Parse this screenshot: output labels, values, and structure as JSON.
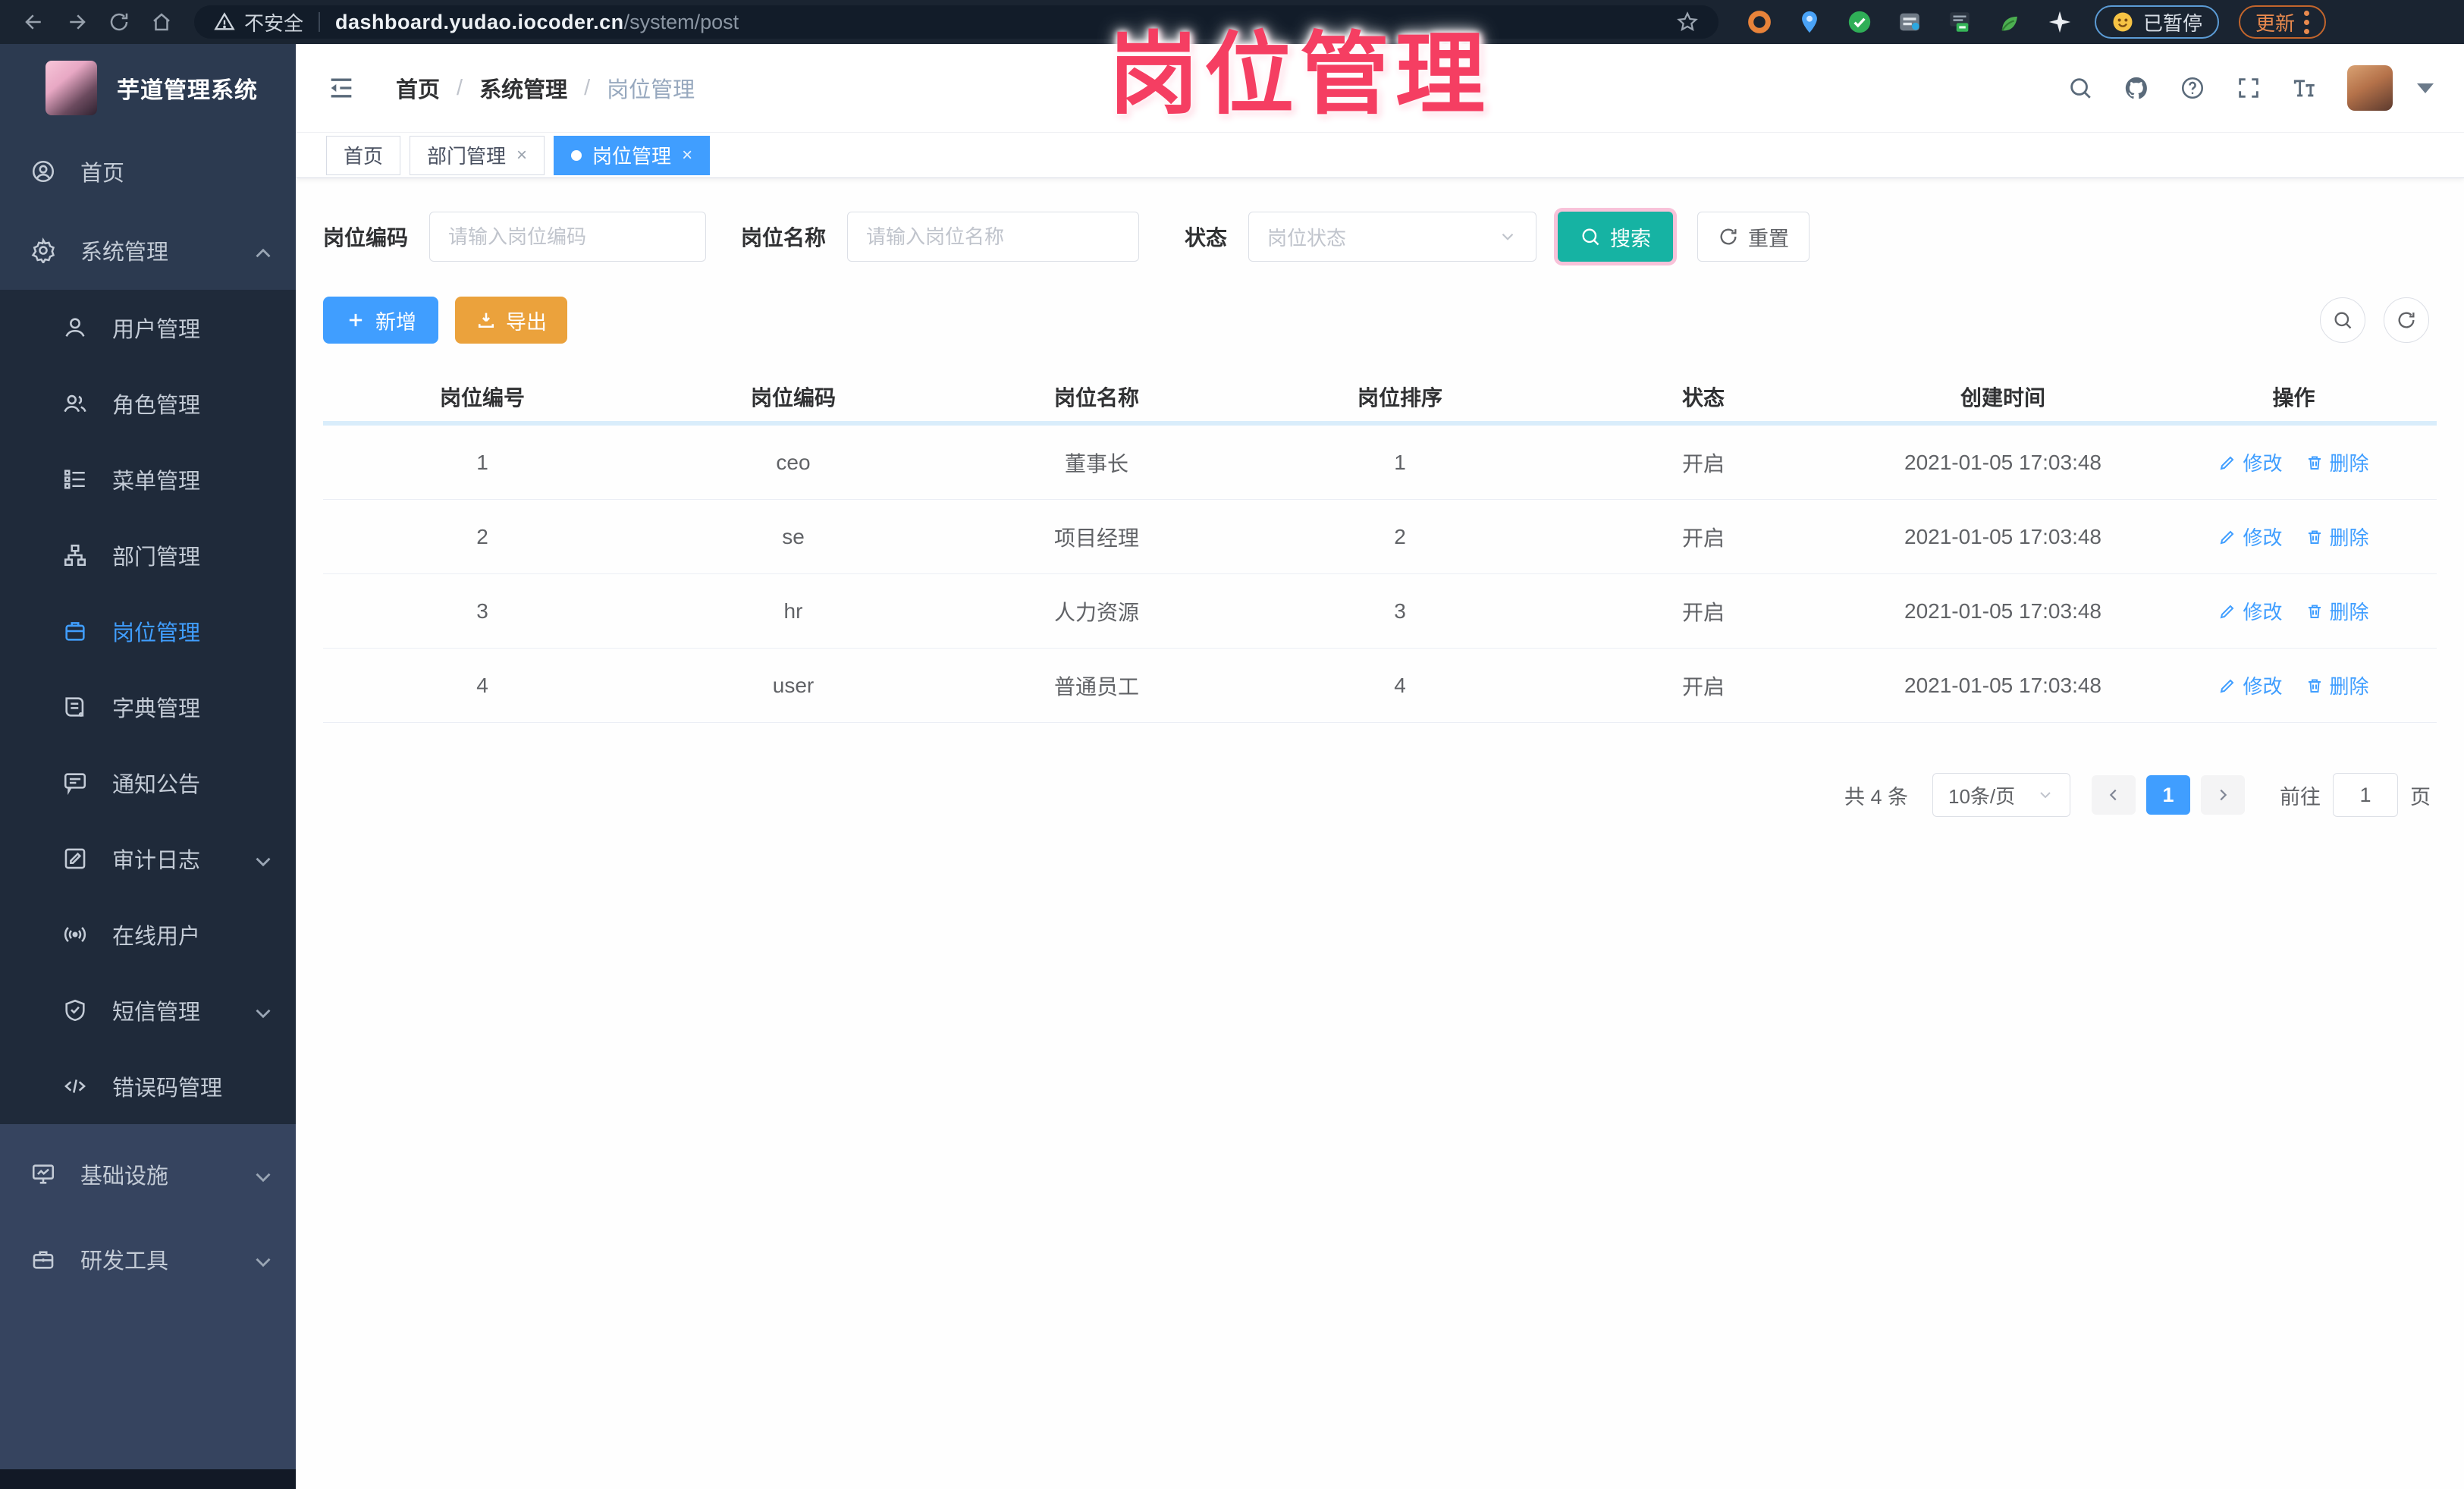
{
  "browser": {
    "security_label": "不安全",
    "url_host": "dashboard.yudao.iocoder.cn",
    "url_path": "/system/post",
    "paused_button": "已暂停",
    "update_button": "更新"
  },
  "sidebar": {
    "title": "芋道管理系统",
    "home": "首页",
    "system": "系统管理",
    "submenu": [
      "用户管理",
      "角色管理",
      "菜单管理",
      "部门管理",
      "岗位管理",
      "字典管理",
      "通知公告",
      "审计日志",
      "在线用户",
      "短信管理",
      "错误码管理"
    ],
    "infra": "基础设施",
    "devtools": "研发工具"
  },
  "header": {
    "breadcrumb": [
      "首页",
      "系统管理",
      "岗位管理"
    ],
    "separator": "/"
  },
  "tabs": [
    "首页",
    "部门管理",
    "岗位管理"
  ],
  "watermark": "岗位管理",
  "filters": {
    "code_label": "岗位编码",
    "code_placeholder": "请输入岗位编码",
    "name_label": "岗位名称",
    "name_placeholder": "请输入岗位名称",
    "status_label": "状态",
    "status_placeholder": "岗位状态",
    "search_button": "搜索",
    "reset_button": "重置"
  },
  "toolbar": {
    "add_button": "新增",
    "export_button": "导出"
  },
  "table": {
    "columns": [
      "岗位编号",
      "岗位编码",
      "岗位名称",
      "岗位排序",
      "状态",
      "创建时间",
      "操作"
    ],
    "rows": [
      {
        "id": "1",
        "code": "ceo",
        "name": "董事长",
        "sort": "1",
        "status": "开启",
        "created": "2021-01-05 17:03:48"
      },
      {
        "id": "2",
        "code": "se",
        "name": "项目经理",
        "sort": "2",
        "status": "开启",
        "created": "2021-01-05 17:03:48"
      },
      {
        "id": "3",
        "code": "hr",
        "name": "人力资源",
        "sort": "3",
        "status": "开启",
        "created": "2021-01-05 17:03:48"
      },
      {
        "id": "4",
        "code": "user",
        "name": "普通员工",
        "sort": "4",
        "status": "开启",
        "created": "2021-01-05 17:03:48"
      }
    ],
    "edit_action": "修改",
    "delete_action": "删除"
  },
  "pagination": {
    "total": "共 4 条",
    "page_size": "10条/页",
    "current_page": "1",
    "goto_label": "前往",
    "goto_value": "1",
    "page_unit": "页"
  },
  "colors": {
    "accent": "#409eff",
    "search_teal": "#16b3a3",
    "export_orange": "#eba23c",
    "watermark_pink": "#f53e62",
    "sidebar_bg": "#2c3a50",
    "submenu_bg": "#1f2a3a"
  }
}
